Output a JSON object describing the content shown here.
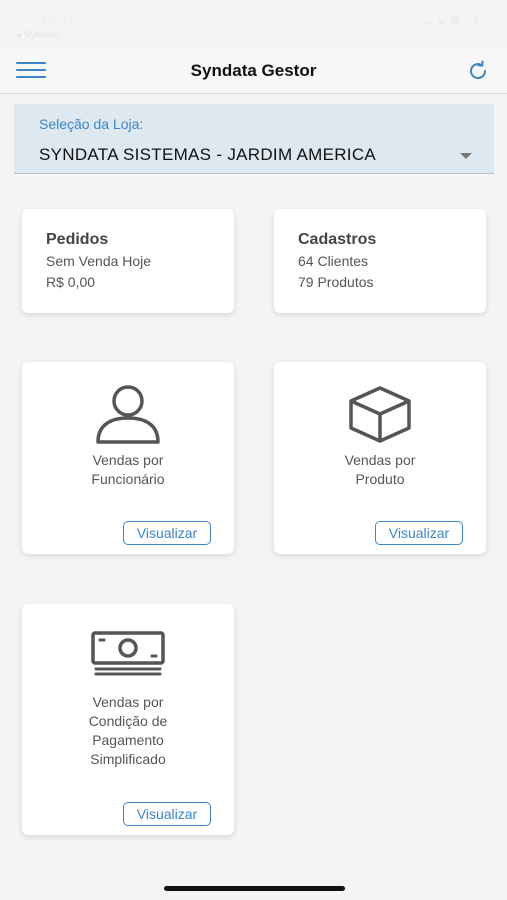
{
  "status_bar": {
    "time": "12:11",
    "back_label": "◂ Syndata"
  },
  "header": {
    "title": "Syndata Gestor"
  },
  "store": {
    "label": "Seleção da Loja:",
    "selected": "SYNDATA SISTEMAS - JARDIM AMERICA"
  },
  "summary_cards": {
    "orders": {
      "title": "Pedidos",
      "line1": "Sem Venda Hoje",
      "line2": "R$ 0,00"
    },
    "registrations": {
      "title": "Cadastros",
      "line1": "64 Clientes",
      "line2": "79 Produtos"
    }
  },
  "reports": {
    "by_employee": {
      "line1": "Vendas por",
      "line2": "Funcionário",
      "button": "Visualizar",
      "icon": "person-icon"
    },
    "by_product": {
      "line1": "Vendas por",
      "line2": "Produto",
      "button": "Visualizar",
      "icon": "box-icon"
    },
    "by_payment": {
      "line1": "Vendas por",
      "line2": "Condição de",
      "line3": "Pagamento",
      "line4": "Simplificado",
      "button": "Visualizar",
      "icon": "money-icon"
    }
  },
  "colors": {
    "accent": "#3a86c8",
    "background": "#f4f4f5",
    "select_bg": "#dde8f0"
  }
}
